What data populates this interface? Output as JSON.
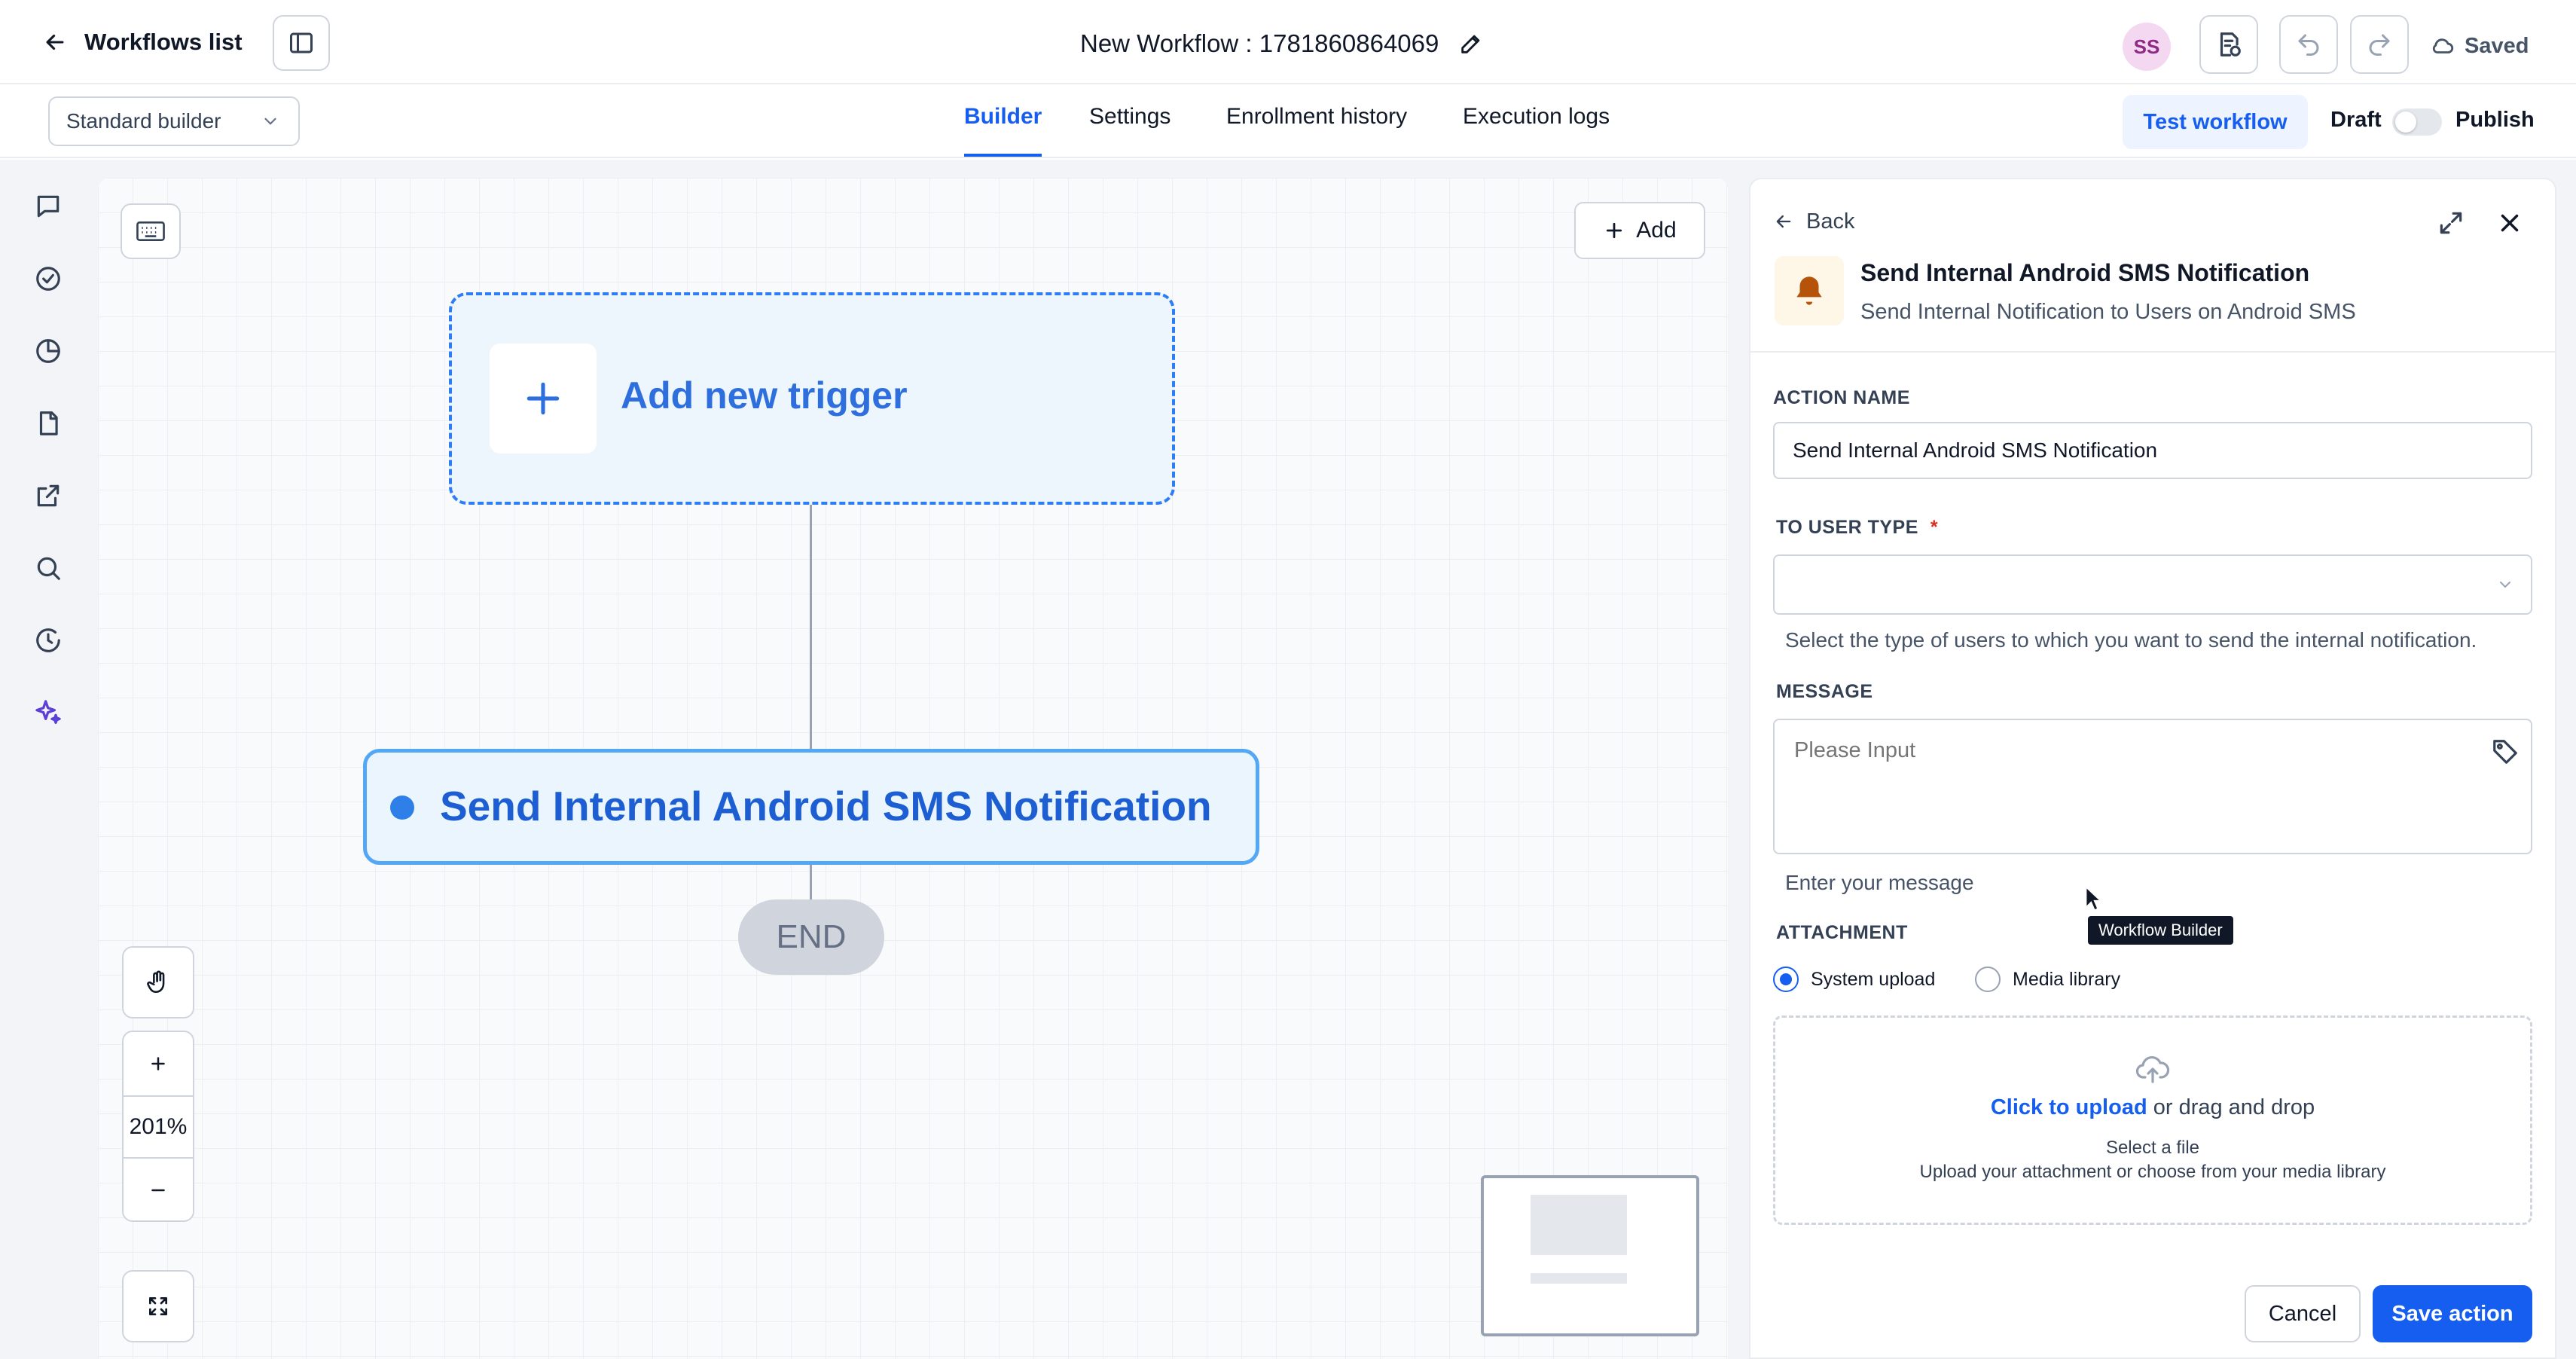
{
  "header": {
    "back_label": "Workflows list",
    "workflow_title": "New Workflow : 1781860864069",
    "avatar_initials": "SS",
    "saved_label": "Saved"
  },
  "subbar": {
    "builder_mode": "Standard builder",
    "tabs": [
      {
        "label": "Builder",
        "active": true
      },
      {
        "label": "Settings",
        "active": false
      },
      {
        "label": "Enrollment history",
        "active": false
      },
      {
        "label": "Execution logs",
        "active": false
      }
    ],
    "test_label": "Test workflow",
    "draft_label": "Draft",
    "publish_label": "Publish",
    "published": false
  },
  "sidebar": {
    "icons": [
      "chat-icon",
      "check-circle-icon",
      "pie-chart-icon",
      "document-icon",
      "external-link-icon",
      "search-icon",
      "history-icon",
      "sparkle-icon"
    ]
  },
  "canvas": {
    "add_label": "Add",
    "trigger_label": "Add new trigger",
    "action_label": "Send Internal Android SMS Notification",
    "end_label": "END",
    "zoom": "201%"
  },
  "panel": {
    "back_label": "Back",
    "title": "Send Internal Android SMS Notification",
    "subtitle": "Send Internal Notification to Users on Android SMS",
    "action_name_label": "ACTION NAME",
    "action_name_value": "Send Internal Android SMS Notification",
    "user_type_label": "TO USER TYPE",
    "required_mark": "*",
    "user_type_help": "Select the type of users to which you want to send the internal notification.",
    "message_label": "MESSAGE",
    "message_placeholder": "Please Input",
    "message_help": "Enter your message",
    "tooltip": "Workflow Builder",
    "attachment_label": "ATTACHMENT",
    "radio_system": "System upload",
    "radio_media": "Media library",
    "upload_link": "Click to upload",
    "upload_rest": " or drag and drop",
    "upload_sub1": "Select a file",
    "upload_sub2": "Upload your attachment or choose from your media library",
    "cancel_label": "Cancel",
    "save_label": "Save action"
  },
  "colors": {
    "accent": "#155eef",
    "trigger_border": "#2e7cf6",
    "action_border": "#53a7f5",
    "required": "#d92d20"
  }
}
